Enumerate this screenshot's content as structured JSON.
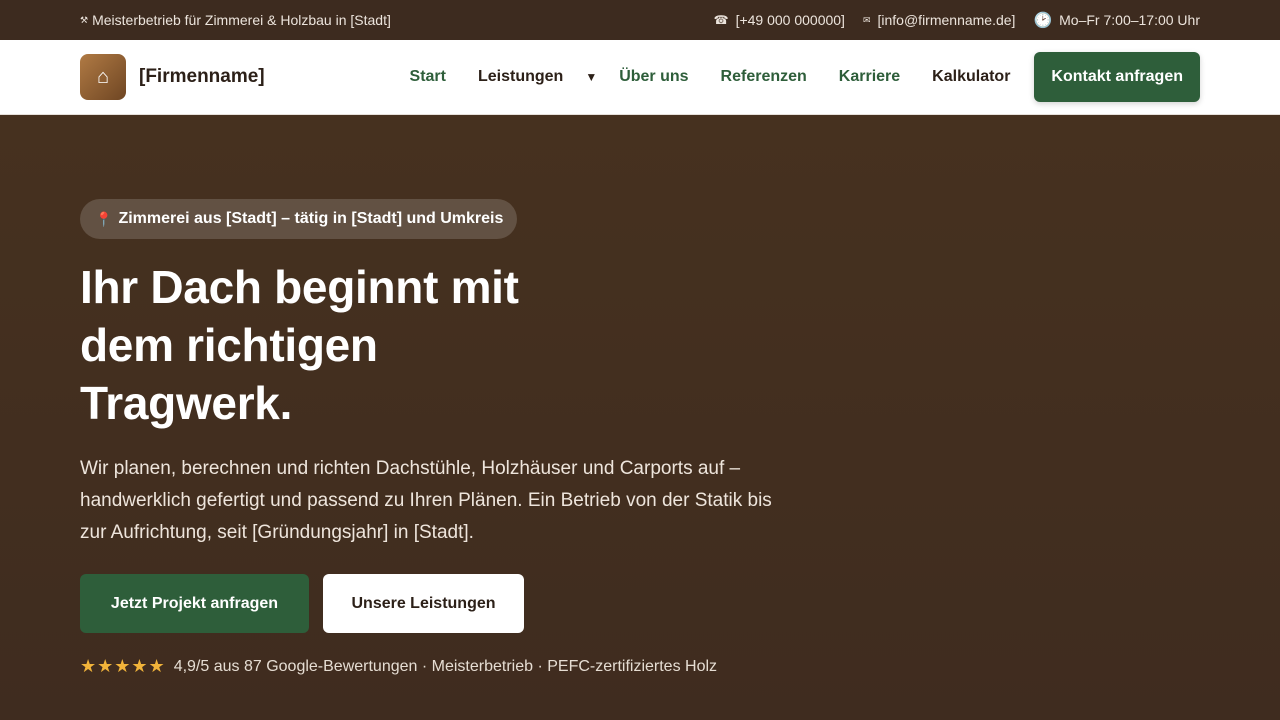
{
  "topbar": {
    "tagline_icon": "⚒",
    "tagline": "Meisterbetrieb für Zimmerei & Holzbau in [Stadt]",
    "phone_icon": "☎",
    "phone": "[+49 000 000000]",
    "email_icon": "✉",
    "email": "[info@firmenname.de]",
    "hours_icon": "🕑",
    "hours": "Mo–Fr 7:00–17:00 Uhr"
  },
  "nav": {
    "logo_icon": "⌂",
    "brand": "[Firmenname]",
    "items": [
      {
        "label": "Start"
      },
      {
        "label": "Leistungen"
      },
      {
        "label": "Über uns"
      },
      {
        "label": "Referenzen"
      },
      {
        "label": "Karriere"
      },
      {
        "label": "Kalkulator"
      }
    ],
    "caret": "▼",
    "cta": "Kontakt anfragen"
  },
  "hero": {
    "badge_icon": "📍",
    "badge": "Zimmerei aus [Stadt] – tätig in [Stadt] und Umkreis",
    "headline": "Ihr Dach beginnt mit dem richtigen Tragwerk.",
    "lead": "Wir planen, berechnen und richten Dachstühle, Holzhäuser und Carports auf – handwerklich gefertigt und passend zu Ihren Plänen. Ein Betrieb von der Statik bis zur Aufrichtung, seit [Gründungsjahr] in [Stadt].",
    "primary_button": "Jetzt Projekt anfragen",
    "secondary_button": "Unsere Leistungen",
    "stars": "★★★★★",
    "rating_text": "4,9/5 aus 87 Google-Bewertungen · Meisterbetrieb · PEFC-zertifiziertes Holz"
  },
  "colors": {
    "brown_dark": "#3d2b1f",
    "hero_bg": "#432f22",
    "green": "#2e5e3a",
    "star": "#f2b43a"
  }
}
